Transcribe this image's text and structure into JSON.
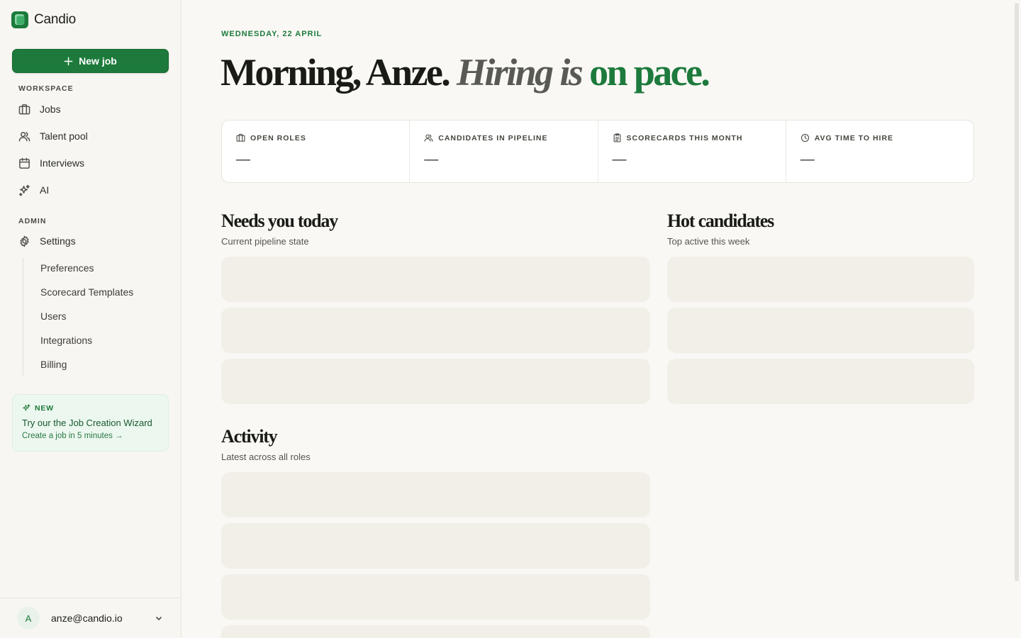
{
  "app": {
    "name": "Candio"
  },
  "sidebar": {
    "new_job_label": "New job",
    "workspace_label": "WORKSPACE",
    "workspace_items": [
      {
        "label": "Jobs",
        "icon": "briefcase-icon"
      },
      {
        "label": "Talent pool",
        "icon": "users-icon"
      },
      {
        "label": "Interviews",
        "icon": "calendar-icon"
      },
      {
        "label": "AI",
        "icon": "sparkles-icon"
      }
    ],
    "admin_label": "ADMIN",
    "settings_label": "Settings",
    "settings_subitems": [
      "Preferences",
      "Scorecard Templates",
      "Users",
      "Integrations",
      "Billing"
    ],
    "promo": {
      "badge": "NEW",
      "title": "Try our the Job Creation Wizard",
      "subtitle": "Create a job in 5 minutes →"
    },
    "user": {
      "initial": "A",
      "email": "anze@candio.io"
    }
  },
  "main": {
    "date": "WEDNESDAY, 22 APRIL",
    "headline": {
      "part1": "Morning, Anze.",
      "part2": "Hiring is",
      "part3": "on pace."
    },
    "stats": [
      {
        "label": "OPEN ROLES",
        "value": "—",
        "icon": "briefcase-icon"
      },
      {
        "label": "CANDIDATES IN PIPELINE",
        "value": "—",
        "icon": "users-icon"
      },
      {
        "label": "SCORECARDS THIS MONTH",
        "value": "—",
        "icon": "clipboard-icon"
      },
      {
        "label": "AVG TIME TO HIRE",
        "value": "—",
        "icon": "clock-icon"
      }
    ],
    "needs": {
      "title": "Needs you today",
      "subtitle": "Current pipeline state"
    },
    "hot": {
      "title": "Hot candidates",
      "subtitle": "Top active this week"
    },
    "activity": {
      "title": "Activity",
      "subtitle": "Latest across all roles"
    }
  },
  "colors": {
    "accent": "#1d7a3c",
    "background": "#f9f8f4",
    "skeleton": "#f1efe7",
    "promo_bg": "#ecf7ef"
  }
}
